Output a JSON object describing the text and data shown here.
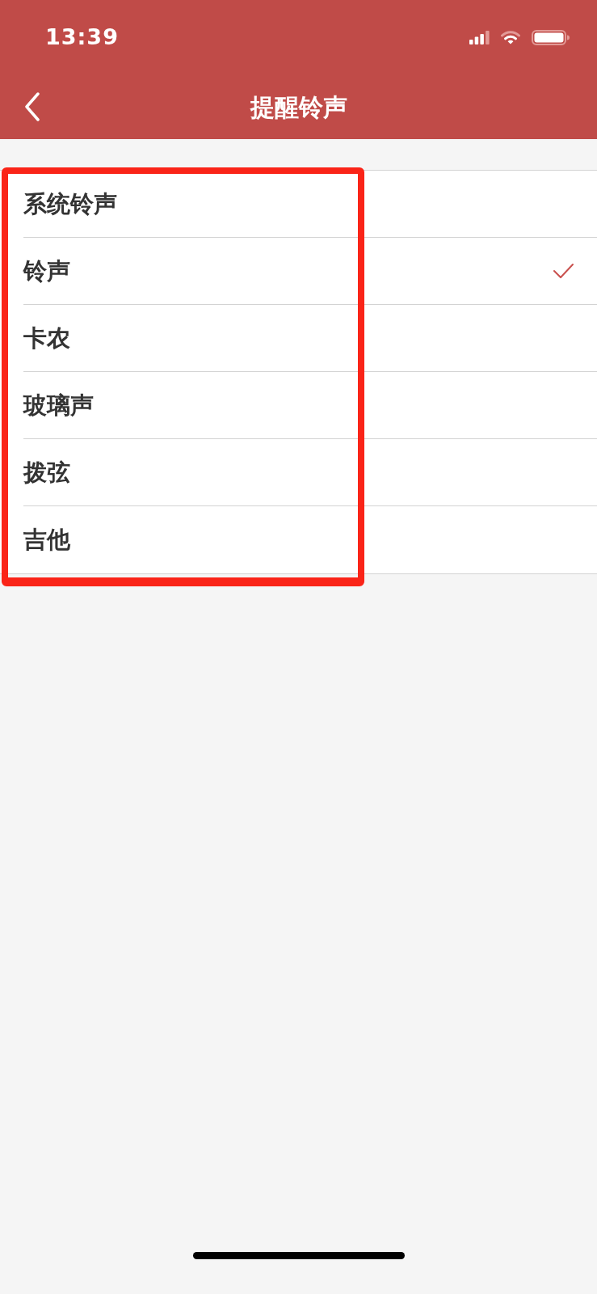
{
  "status_bar": {
    "time": "13:39"
  },
  "nav_bar": {
    "title": "提醒铃声"
  },
  "ringtones": [
    {
      "label": "系统铃声",
      "selected": false
    },
    {
      "label": "铃声",
      "selected": true
    },
    {
      "label": "卡农",
      "selected": false
    },
    {
      "label": "玻璃声",
      "selected": false
    },
    {
      "label": "拨弦",
      "selected": false
    },
    {
      "label": "吉他",
      "selected": false
    }
  ]
}
